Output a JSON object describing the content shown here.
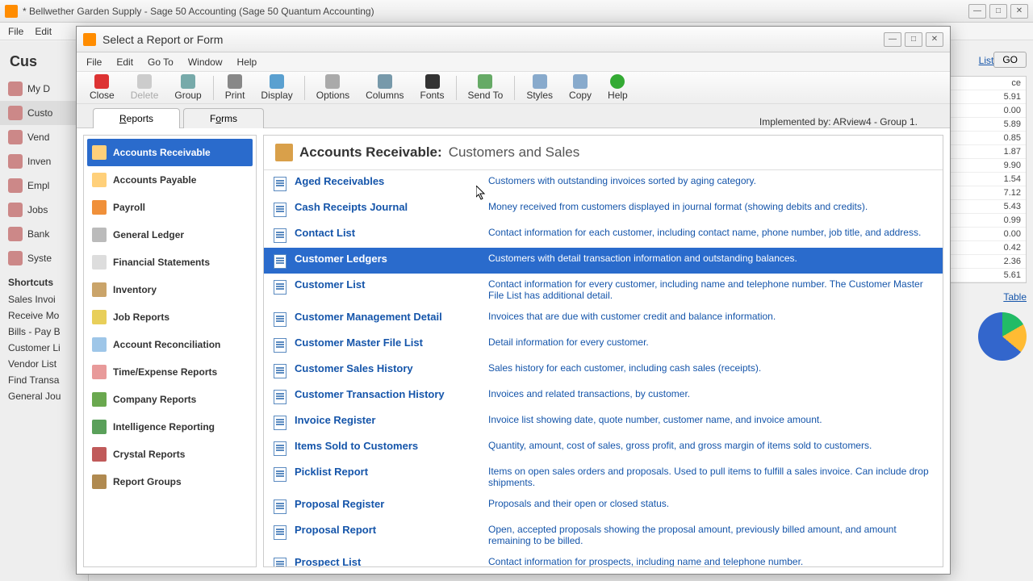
{
  "main_window": {
    "title": "* Bellwether Garden Supply - Sage 50 Accounting (Sage 50 Quantum Accounting)",
    "menu": {
      "file": "File",
      "edit": "Edit"
    },
    "heading": "Cus",
    "nav": {
      "items": [
        {
          "label": "My D"
        },
        {
          "label": "Custo"
        },
        {
          "label": "Vend"
        },
        {
          "label": "Inven"
        },
        {
          "label": "Empl"
        },
        {
          "label": "Jobs"
        },
        {
          "label": "Bank"
        },
        {
          "label": "Syste"
        }
      ]
    },
    "shortcuts_label": "Shortcuts",
    "shortcuts": [
      "Sales Invoi",
      "Receive Mo",
      "Bills - Pay B",
      "Customer Li",
      "Vendor List",
      "Find Transa",
      "General Jou"
    ],
    "go": "GO",
    "right_link_list": "List",
    "right_values": [
      "ce",
      "5.91",
      "0.00",
      "5.89",
      "0.85",
      "1.87",
      "9.90",
      "1.54",
      "7.12",
      "5.43",
      "0.99",
      "0.00",
      "0.42",
      "2.36",
      "5.61"
    ],
    "right_link_table": "Table"
  },
  "dialog": {
    "title": "Select a Report or Form",
    "menu": {
      "file": "File",
      "edit": "Edit",
      "goto": "Go To",
      "window": "Window",
      "help": "Help"
    },
    "toolbar": {
      "close": "Close",
      "delete": "Delete",
      "group": "Group",
      "print": "Print",
      "display": "Display",
      "options": "Options",
      "columns": "Columns",
      "fonts": "Fonts",
      "sendto": "Send To",
      "styles": "Styles",
      "copy": "Copy",
      "help": "Help"
    },
    "tabs": {
      "reports": "Reports",
      "forms": "Forms"
    },
    "implemented_by": "Implemented by: ARview4 - Group 1.",
    "categories": [
      {
        "label": "Accounts Receivable",
        "color": "#ffd07a"
      },
      {
        "label": "Accounts Payable",
        "color": "#ffd07a"
      },
      {
        "label": "Payroll",
        "color": "#f0903a"
      },
      {
        "label": "General Ledger",
        "color": "#bbb"
      },
      {
        "label": "Financial Statements",
        "color": "#ddd"
      },
      {
        "label": "Inventory",
        "color": "#caa46a"
      },
      {
        "label": "Job Reports",
        "color": "#e8cf5a"
      },
      {
        "label": "Account Reconciliation",
        "color": "#9ec6e8"
      },
      {
        "label": "Time/Expense Reports",
        "color": "#e89a9a"
      },
      {
        "label": "Company Reports",
        "color": "#6aa84f"
      },
      {
        "label": "Intelligence Reporting",
        "color": "#5aa05a"
      },
      {
        "label": "Crystal Reports",
        "color": "#c05a5a"
      },
      {
        "label": "Report Groups",
        "color": "#b08a50"
      }
    ],
    "pane_header": {
      "main": "Accounts Receivable:",
      "sub": "Customers and Sales"
    },
    "reports": [
      {
        "name": "Aged Receivables",
        "desc": "Customers with outstanding invoices sorted by aging category."
      },
      {
        "name": "Cash Receipts Journal",
        "desc": "Money received from customers displayed in journal format (showing debits and credits)."
      },
      {
        "name": "Contact List",
        "desc": "Contact information for each customer, including contact name, phone number, job title, and address."
      },
      {
        "name": "Customer Ledgers",
        "desc": "Customers with detail transaction information and outstanding balances."
      },
      {
        "name": "Customer List",
        "desc": "Contact information for every customer, including name and telephone number. The Customer Master File List has additional detail."
      },
      {
        "name": "Customer Management Detail",
        "desc": "Invoices that are due with customer credit and balance information."
      },
      {
        "name": "Customer Master File List",
        "desc": "Detail information for every customer."
      },
      {
        "name": "Customer Sales History",
        "desc": "Sales history for each customer, including cash sales (receipts)."
      },
      {
        "name": "Customer Transaction History",
        "desc": "Invoices and related transactions, by customer."
      },
      {
        "name": "Invoice Register",
        "desc": "Invoice list showing date, quote number, customer name, and invoice amount."
      },
      {
        "name": "Items Sold to Customers",
        "desc": "Quantity, amount, cost of sales, gross profit, and gross margin of items sold to customers."
      },
      {
        "name": "Picklist Report",
        "desc": "Items on open sales orders and proposals. Used to pull items to fulfill a sales invoice.  Can include drop shipments."
      },
      {
        "name": "Proposal Register",
        "desc": "Proposals and their open or closed status."
      },
      {
        "name": "Proposal Report",
        "desc": "Open, accepted proposals showing the proposal amount, previously billed amount, and amount remaining to be billed."
      },
      {
        "name": "Prospect List",
        "desc": "Contact information for prospects, including name and telephone number."
      }
    ],
    "selected_report_index": 3,
    "selected_category_index": 0
  }
}
